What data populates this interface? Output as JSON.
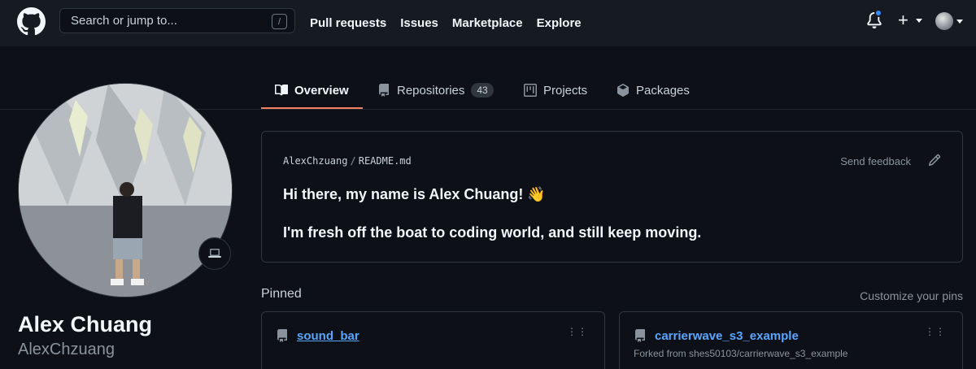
{
  "header": {
    "search_placeholder": "Search or jump to...",
    "search_shortcut": "/",
    "nav": [
      "Pull requests",
      "Issues",
      "Marketplace",
      "Explore"
    ],
    "plus_label": "+"
  },
  "tabs": [
    {
      "label": "Overview",
      "icon": "book-icon",
      "active": true
    },
    {
      "label": "Repositories",
      "icon": "repo-icon",
      "count": "43"
    },
    {
      "label": "Projects",
      "icon": "project-icon"
    },
    {
      "label": "Packages",
      "icon": "package-icon"
    }
  ],
  "profile": {
    "name": "Alex Chuang",
    "login": "AlexChzuang"
  },
  "readme": {
    "owner": "AlexChzuang",
    "separator": "/",
    "file": "README.md",
    "feedback": "Send feedback",
    "line1": "Hi there, my name is Alex Chuang! 👋",
    "line2": "I'm fresh off the boat to coding world, and still keep moving."
  },
  "pinned": {
    "title": "Pinned",
    "customize": "Customize your pins",
    "items": [
      {
        "name": "sound_bar",
        "subtitle": ""
      },
      {
        "name": "carrierwave_s3_example",
        "subtitle": "Forked from shes50103/carrierwave_s3_example"
      }
    ]
  },
  "colors": {
    "background": "#0d1117",
    "header": "#161b22",
    "accent_underline": "#f78166",
    "link": "#58a6ff",
    "notification_dot": "#388bfd"
  }
}
